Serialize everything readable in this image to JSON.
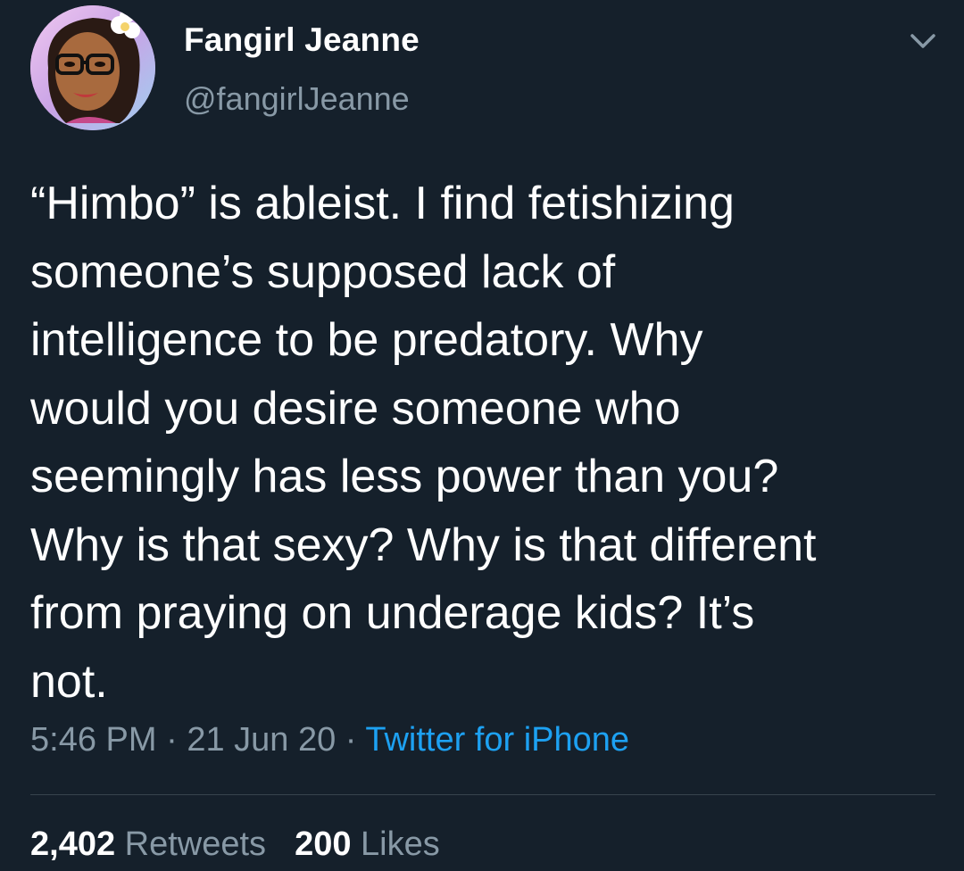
{
  "author": {
    "name": "Fangirl Jeanne",
    "handle": "@fangirlJeanne",
    "avatar_icon": "cartoon-avatar-woman-glasses-flower"
  },
  "tweet": {
    "lines": [
      "“Himbo” is ableist. I find fetishizing",
      "someone’s supposed lack of",
      "intelligence to be predatory. Why",
      "would you desire someone who",
      "seemingly has less power than you?",
      "Why is that sexy? Why is that different",
      "from praying on underage kids? It’s",
      "not."
    ]
  },
  "meta": {
    "time": "5:46 PM",
    "separator": " · ",
    "date": "21 Jun 20",
    "source": "Twitter for iPhone"
  },
  "stats": {
    "retweets_count": "2,402",
    "retweets_label": "Retweets",
    "likes_count": "200",
    "likes_label": "Likes"
  },
  "colors": {
    "background": "#15202b",
    "text": "#ffffff",
    "muted": "#8899a6",
    "accent": "#1da1f2",
    "divider": "#38444d"
  }
}
